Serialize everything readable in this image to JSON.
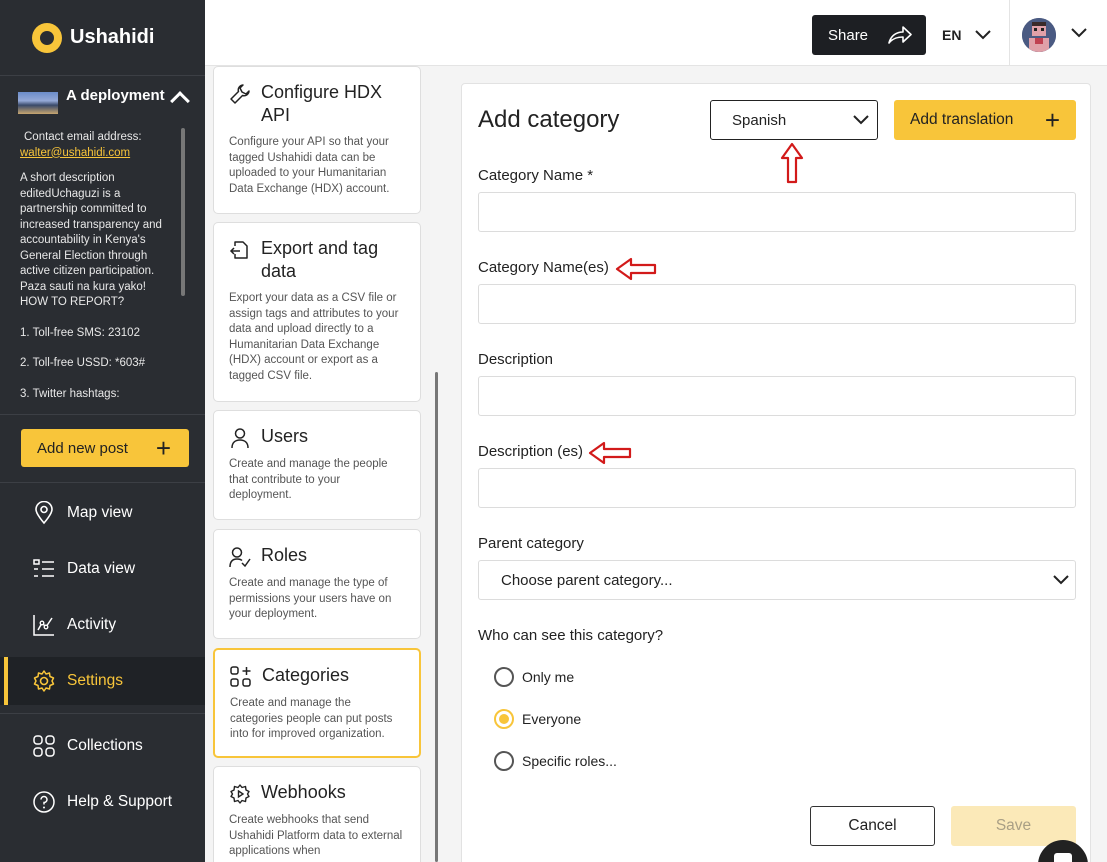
{
  "brand": {
    "name": "Ushahidi",
    "accent": "#f8c53a",
    "sidebar_bg": "#2a2d32"
  },
  "deployment": {
    "title": "A deployment",
    "contact_label": "Contact email address:",
    "contact_email": "walter@ushahidi.com",
    "description": "A short description editedUchaguzi is a partnership committed to increased transparency and accountability in Kenya's General Election through active citizen participation. Paza sauti na kura yako! HOW TO REPORT?",
    "line1": "1. Toll-free SMS: 23102",
    "line2": "2. Toll-free USSD: *603#",
    "line3": "3. Twitter hashtags:"
  },
  "sidebar": {
    "add_post_label": "Add new post",
    "items": [
      {
        "label": "Map view",
        "icon": "map-pin-icon"
      },
      {
        "label": "Data view",
        "icon": "list-icon"
      },
      {
        "label": "Activity",
        "icon": "activity-icon"
      },
      {
        "label": "Settings",
        "icon": "gear-icon"
      },
      {
        "label": "Collections",
        "icon": "grid-icon"
      },
      {
        "label": "Help & Support",
        "icon": "help-icon"
      }
    ]
  },
  "topbar": {
    "share_label": "Share",
    "language": "EN"
  },
  "settings_cards": [
    {
      "title": "Configure HDX API",
      "desc": "Configure your API so that your tagged Ushahidi data can be uploaded to your Humanitarian Data Exchange (HDX) account.",
      "icon": "wrench-icon"
    },
    {
      "title": "Export and tag data",
      "desc": "Export your data as a CSV file or assign tags and attributes to your data and upload directly to a Humanitarian Data Exchange (HDX) account or export as a tagged CSV file.",
      "icon": "export-icon"
    },
    {
      "title": "Users",
      "desc": "Create and manage the people that contribute to your deployment.",
      "icon": "user-icon"
    },
    {
      "title": "Roles",
      "desc": "Create and manage the type of permissions your users have on your deployment.",
      "icon": "user-check-icon"
    },
    {
      "title": "Categories",
      "desc": "Create and manage the categories people can put posts into for improved organization.",
      "icon": "categories-icon"
    },
    {
      "title": "Webhooks",
      "desc": "Create webhooks that send Ushahidi Platform data to external applications when",
      "icon": "webhook-icon"
    }
  ],
  "form": {
    "title": "Add category",
    "translation_language": "Spanish",
    "add_translation_label": "Add translation",
    "name_label": "Category Name *",
    "name_es_label": "Category Name(es)",
    "description_label": "Description",
    "description_es_label": "Description (es)",
    "parent_label": "Parent category",
    "parent_placeholder": "Choose parent category...",
    "visibility_label": "Who can see this category?",
    "visibility_options": [
      "Only me",
      "Everyone",
      "Specific roles..."
    ],
    "visibility_selected": "Everyone",
    "cancel_label": "Cancel",
    "save_label": "Save"
  }
}
